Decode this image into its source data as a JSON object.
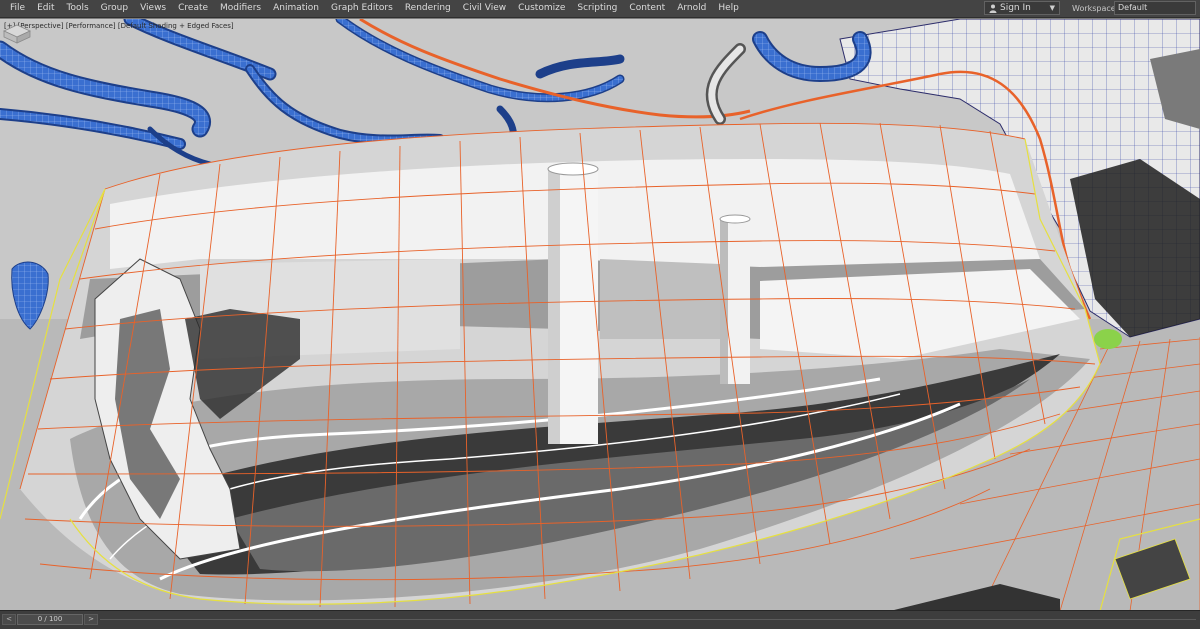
{
  "menubar": {
    "items": [
      "File",
      "Edit",
      "Tools",
      "Group",
      "Views",
      "Create",
      "Modifiers",
      "Animation",
      "Graph Editors",
      "Rendering",
      "Civil View",
      "Customize",
      "Scripting",
      "Content",
      "Arnold",
      "Help"
    ],
    "signin_label": "Sign In",
    "workspaces_label": "Workspaces:",
    "workspace_value": "Default"
  },
  "viewport": {
    "label_plus": "[+]",
    "label_view": "[Perspective]",
    "label_mode": "[Performance]",
    "label_shading": "[Default Shading + Edged Faces]"
  },
  "timeslider": {
    "frame_readout": "0 / 100",
    "prev": "<",
    "next": ">"
  },
  "colors": {
    "menubar_bg": "#444444",
    "viewport_bg": "#c8c8c8",
    "selection_orange": "#e8622a",
    "wire_blue": "#2f63c8",
    "highlight_yellow": "#e6e040"
  },
  "icons": [
    "user-icon",
    "chevron-down-icon",
    "viewcube-icon"
  ]
}
